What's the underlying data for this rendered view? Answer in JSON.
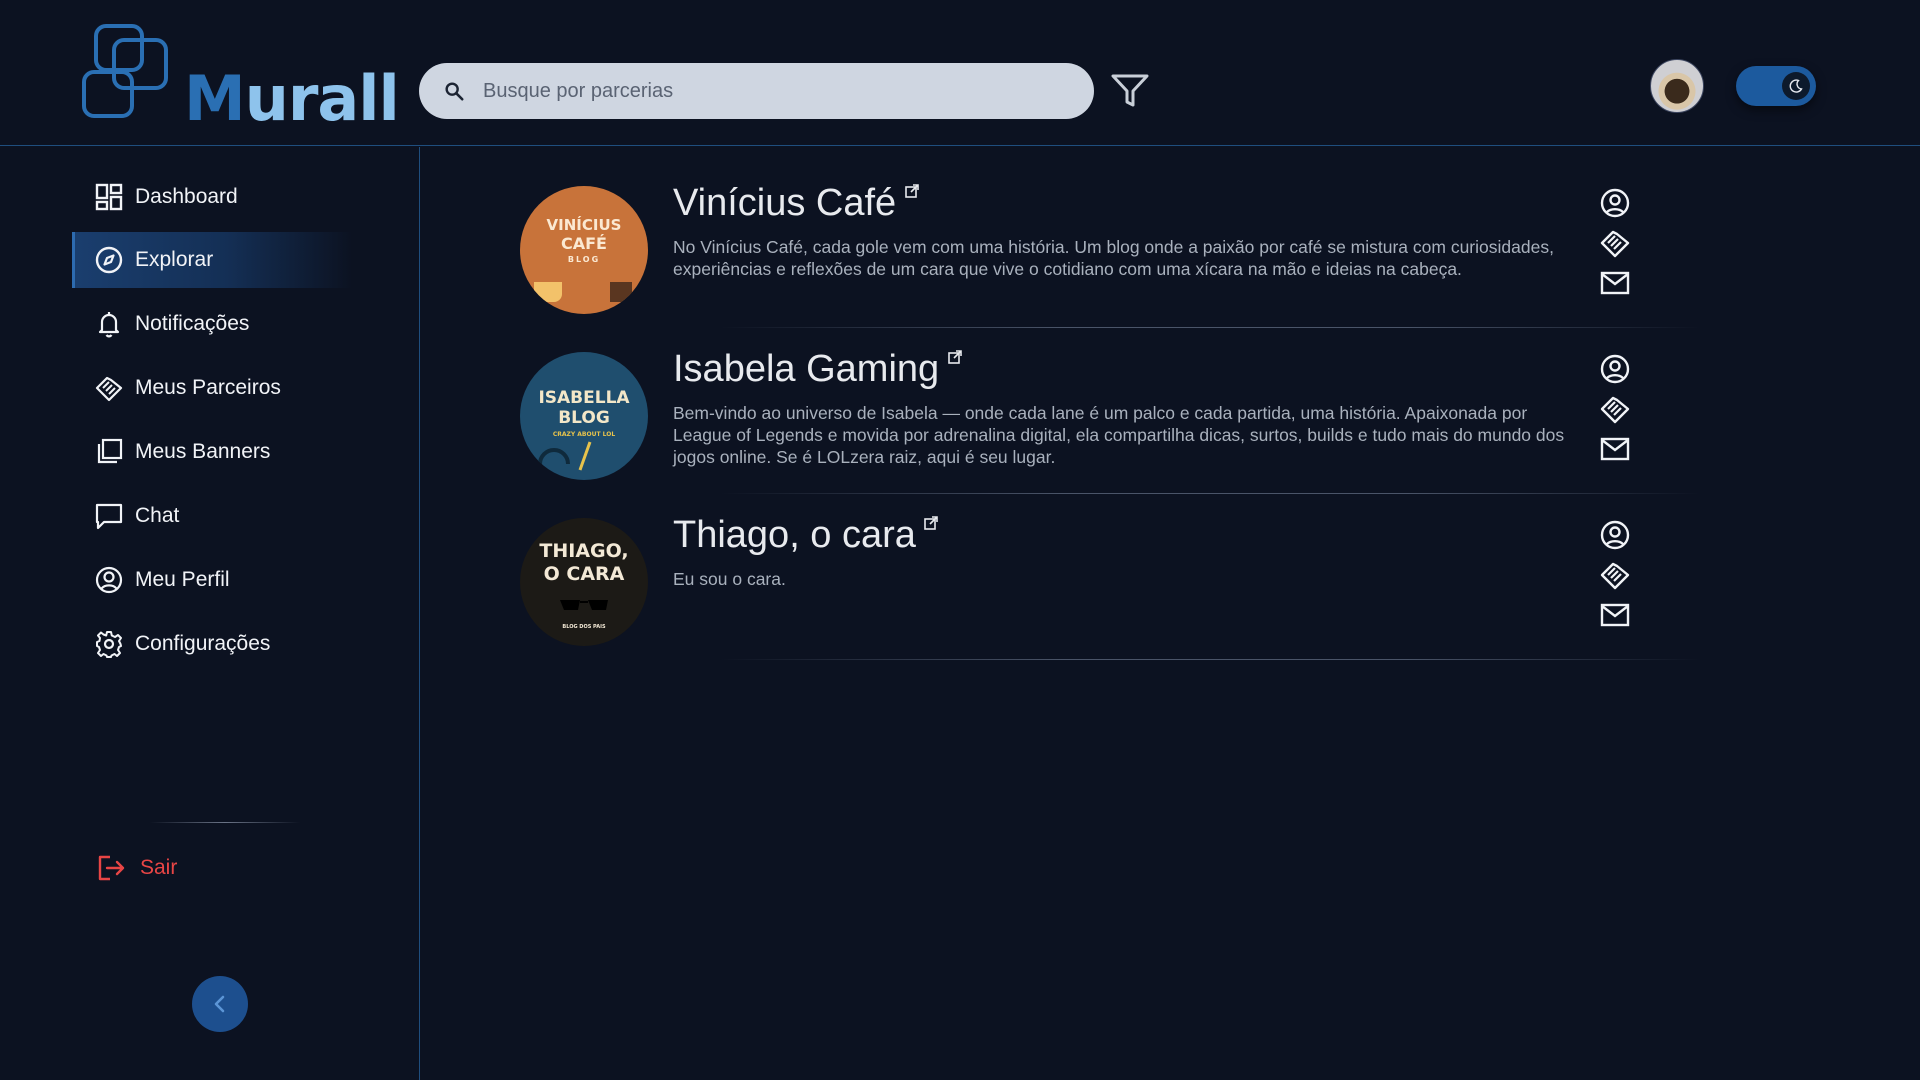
{
  "header": {
    "logo_text_m": "M",
    "logo_text_rest": "urall",
    "search_placeholder": "Busque por parcerias",
    "theme": "dark"
  },
  "sidebar": {
    "items": [
      {
        "label": "Dashboard",
        "icon": "dashboard-icon",
        "active": false
      },
      {
        "label": "Explorar",
        "icon": "compass-icon",
        "active": true
      },
      {
        "label": "Notificações",
        "icon": "bell-icon",
        "active": false
      },
      {
        "label": "Meus Parceiros",
        "icon": "handshake-icon",
        "active": false
      },
      {
        "label": "Meus Banners",
        "icon": "banners-icon",
        "active": false
      },
      {
        "label": "Chat",
        "icon": "chat-icon",
        "active": false
      },
      {
        "label": "Meu Perfil",
        "icon": "user-circle-icon",
        "active": false
      },
      {
        "label": "Configurações",
        "icon": "gear-icon",
        "active": false
      }
    ],
    "logout_label": "Sair"
  },
  "results": [
    {
      "title": "Vinícius Café",
      "description": "No Vinícius Café, cada gole vem com uma história. Um blog onde a paixão por café se mistura com curiosidades, experiências e reflexões de um cara que vive o cotidiano com uma xícara na mão e ideias na cabeça.",
      "thumb_lines": [
        "VINÍCIUS",
        "CAFÉ",
        "BLOG"
      ],
      "thumb_color": "#c8733a"
    },
    {
      "title": "Isabela Gaming",
      "description": "Bem-vindo ao universo de Isabela — onde cada lane é um palco e cada partida, uma história. Apaixonada por League of Legends e movida por adrenalina digital, ela compartilha dicas, surtos, builds e tudo mais do mundo dos jogos online. Se é LOLzera raiz, aqui é seu lugar.",
      "thumb_lines": [
        "ISABELLA",
        "BLOG",
        "CRAZY ABOUT LOL"
      ],
      "thumb_color": "#1f4e6e"
    },
    {
      "title": "Thiago, o cara",
      "description": "Eu sou o cara.",
      "thumb_lines": [
        "THIAGO,",
        "O CARA",
        "BLOG DOS PAIS"
      ],
      "thumb_color": "#1c1a16"
    }
  ],
  "colors": {
    "background": "#0c1221",
    "accent": "#1d4f8e",
    "danger": "#e84545"
  }
}
